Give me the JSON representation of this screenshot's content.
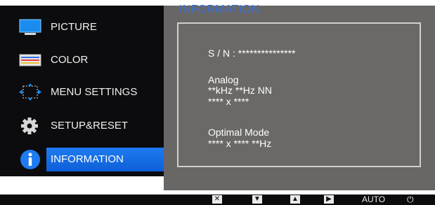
{
  "menu": {
    "items": [
      {
        "label": "PICTURE",
        "icon": "monitor-icon"
      },
      {
        "label": "COLOR",
        "icon": "color-palette-icon"
      },
      {
        "label": "MENU SETTINGS",
        "icon": "menu-settings-icon"
      },
      {
        "label": "SETUP&RESET",
        "icon": "gear-icon"
      },
      {
        "label": "INFORMATION",
        "icon": "info-icon",
        "selected": true
      }
    ]
  },
  "panel": {
    "title": "INFORMATION",
    "serial": "S / N : ***************",
    "signal_type": "Analog",
    "frequency": "**kHz **Hz NN",
    "resolution": "**** x ****",
    "optimal_mode_label": "Optimal Mode",
    "optimal_mode_value": "**** x **** **Hz"
  },
  "bottom_bar": {
    "close_symbol": "✕",
    "down_symbol": "▼",
    "up_symbol": "▲",
    "right_symbol": "▶",
    "auto_label": "AUTO",
    "power_symbol": "⏻"
  },
  "colors": {
    "accent": "#1e7bf0",
    "title_blue": "#3d6fd3",
    "menu_bg": "#0c0c0e",
    "panel_bg": "#686765"
  }
}
